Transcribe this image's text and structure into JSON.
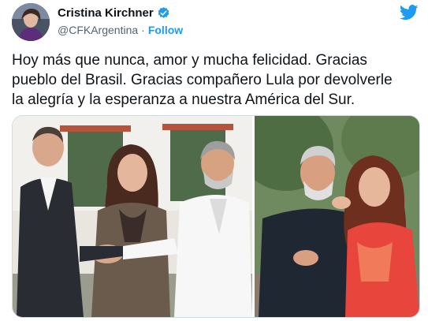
{
  "author": {
    "display_name": "Cristina Kirchner",
    "handle": "@CFKArgentina",
    "separator": "·",
    "follow_label": "Follow"
  },
  "tweet": {
    "text": "Hoy más que nunca, amor y mucha felicidad. Gracias\npueblo del Brasil. Gracias compañero Lula por devolverle\nla alegría y la esperanza a nuestra América del Sur."
  },
  "icons": {
    "verified": "verified-badge-icon",
    "brand": "twitter-bird-icon"
  },
  "colors": {
    "accent": "#1d9bf0",
    "text": "#0f1419",
    "secondary": "#536471"
  }
}
